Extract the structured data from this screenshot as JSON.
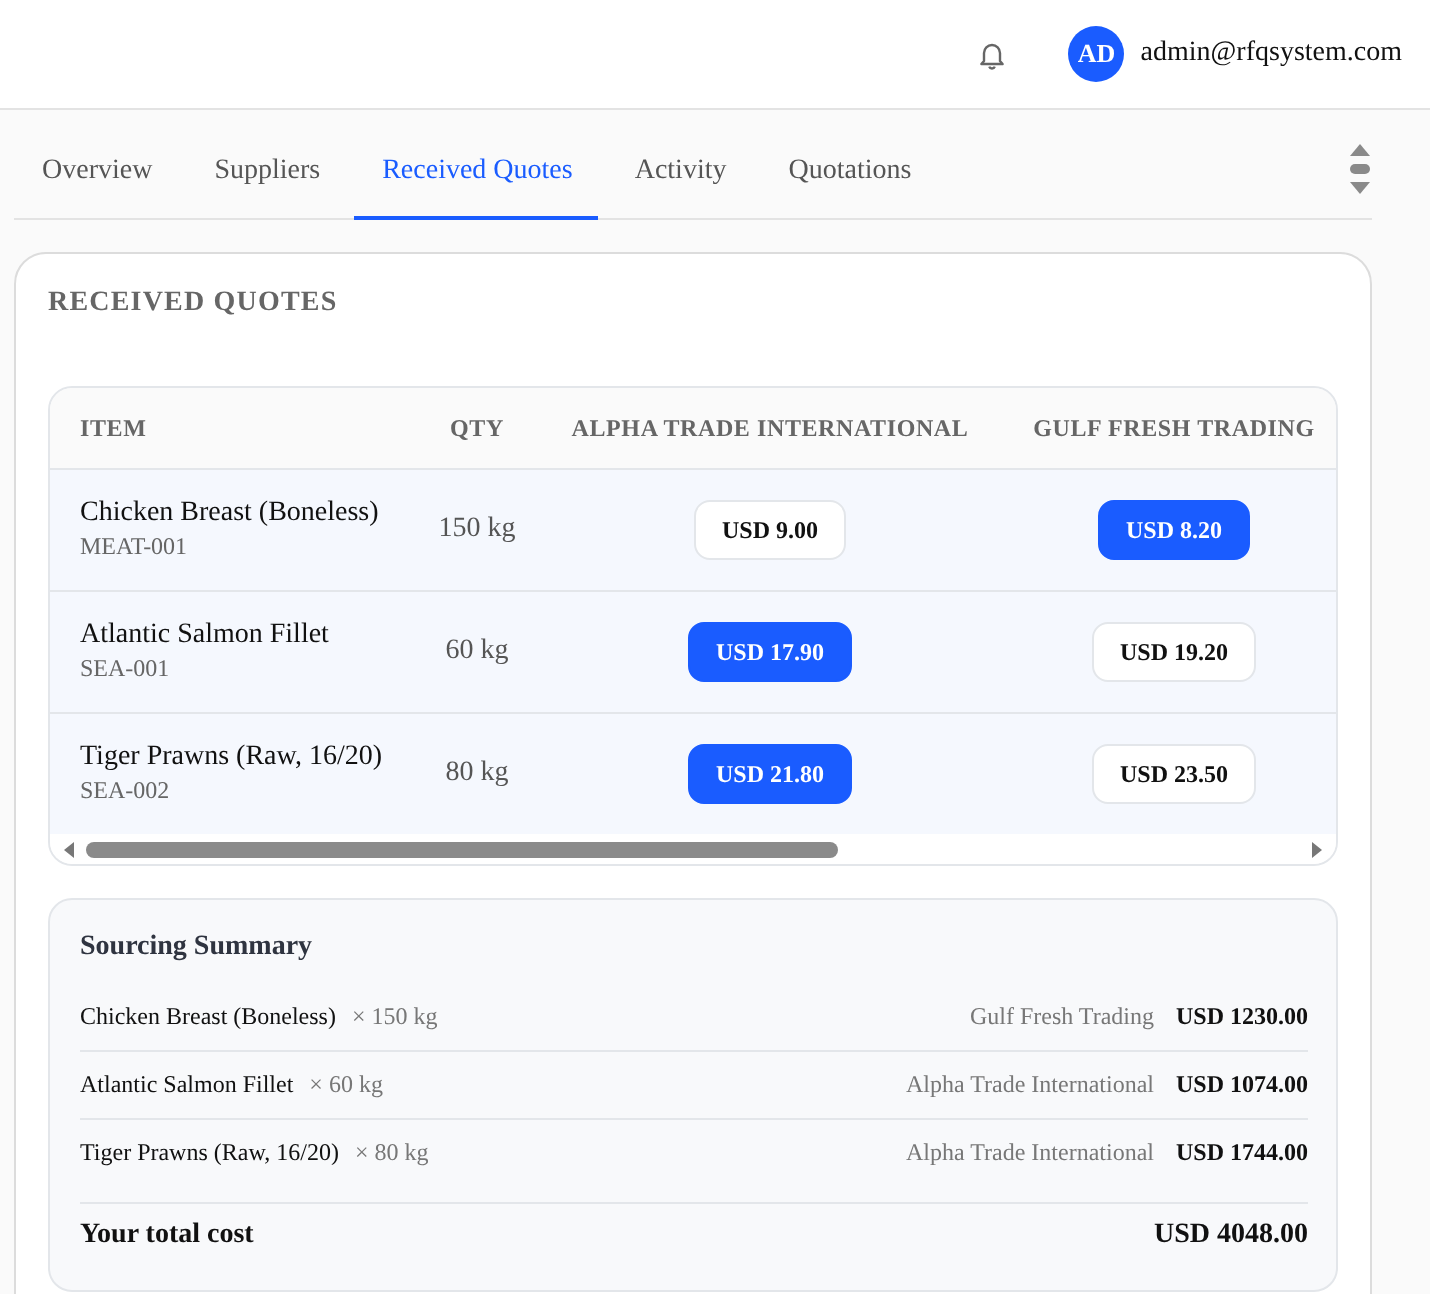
{
  "header": {
    "avatar_initials": "AD",
    "email": "admin@rfqsystem.com"
  },
  "tabs": [
    {
      "label": "Overview",
      "selected": false
    },
    {
      "label": "Suppliers",
      "selected": false
    },
    {
      "label": "Received Quotes",
      "selected": true
    },
    {
      "label": "Activity",
      "selected": false
    },
    {
      "label": "Quotations",
      "selected": false
    }
  ],
  "section": {
    "title": "RECEIVED QUOTES"
  },
  "quotes_table": {
    "columns": [
      "ITEM",
      "QTY",
      "ALPHA TRADE INTERNATIONAL",
      "GULF FRESH TRADING"
    ],
    "rows": [
      {
        "name": "Chicken Breast (Boneless)",
        "code": "MEAT-001",
        "qty": "150 kg",
        "quotes": [
          {
            "price": "USD 9.00",
            "selected": false
          },
          {
            "price": "USD 8.20",
            "selected": true
          }
        ]
      },
      {
        "name": "Atlantic Salmon Fillet",
        "code": "SEA-001",
        "qty": "60 kg",
        "quotes": [
          {
            "price": "USD 17.90",
            "selected": true
          },
          {
            "price": "USD 19.20",
            "selected": false
          }
        ]
      },
      {
        "name": "Tiger Prawns (Raw, 16/20)",
        "code": "SEA-002",
        "qty": "80 kg",
        "quotes": [
          {
            "price": "USD 21.80",
            "selected": true
          },
          {
            "price": "USD 23.50",
            "selected": false
          }
        ]
      }
    ]
  },
  "summary": {
    "title": "Sourcing Summary",
    "rows": [
      {
        "item": "Chicken Breast (Boneless)",
        "qty": "× 150 kg",
        "supplier": "Gulf Fresh Trading",
        "cost": "USD 1230.00"
      },
      {
        "item": "Atlantic Salmon Fillet",
        "qty": "× 60 kg",
        "supplier": "Alpha Trade International",
        "cost": "USD 1074.00"
      },
      {
        "item": "Tiger Prawns (Raw, 16/20)",
        "qty": "× 80 kg",
        "supplier": "Alpha Trade International",
        "cost": "USD 1744.00"
      }
    ],
    "total_label": "Your total cost",
    "total": "USD 4048.00"
  }
}
